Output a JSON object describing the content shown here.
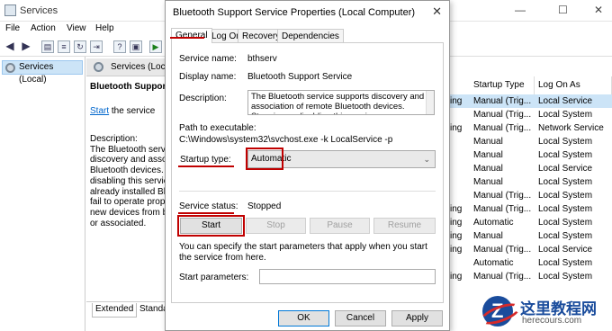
{
  "services_window": {
    "title": "Services",
    "controls": {
      "minimize": "—",
      "maximize": "☐",
      "close": "✕"
    },
    "menu": [
      "File",
      "Action",
      "View",
      "Help"
    ],
    "tree_item": "Services (Local)",
    "header": "Services (Local)",
    "desc_pane": {
      "title": "Bluetooth Support",
      "link": "Start",
      "link_suffix": " the service",
      "description_heading": "Description:",
      "description_lines": [
        "The Bluetooth servi",
        "discovery and asso",
        "Bluetooth devices.",
        "disabling this servic",
        "already installed Blu",
        "fail to operate prop",
        "new devices from b",
        "or associated."
      ]
    },
    "bottom_tabs": [
      "Extended",
      "Standa"
    ],
    "columns": {
      "startup_type": "Startup Type",
      "log_on_as": "Log On As"
    },
    "partial_cells": [
      "ing",
      "",
      "ing",
      "",
      "",
      "",
      "",
      "",
      "ing",
      "ing",
      "ing",
      "ing",
      "",
      "ing"
    ],
    "rows": [
      {
        "startup": "Manual (Trig...",
        "logon": "Local Service",
        "selected": true
      },
      {
        "startup": "Manual (Trig...",
        "logon": "Local System"
      },
      {
        "startup": "Manual (Trig...",
        "logon": "Network Service"
      },
      {
        "startup": "Manual",
        "logon": "Local System"
      },
      {
        "startup": "Manual",
        "logon": "Local System"
      },
      {
        "startup": "Manual",
        "logon": "Local Service"
      },
      {
        "startup": "Manual",
        "logon": "Local System"
      },
      {
        "startup": "Manual (Trig...",
        "logon": "Local System"
      },
      {
        "startup": "Manual (Trig...",
        "logon": "Local System"
      },
      {
        "startup": "Automatic",
        "logon": "Local System"
      },
      {
        "startup": "Manual",
        "logon": "Local System"
      },
      {
        "startup": "Manual (Trig...",
        "logon": "Local Service"
      },
      {
        "startup": "Automatic",
        "logon": "Local System"
      },
      {
        "startup": "Manual (Trig...",
        "logon": "Local System"
      }
    ]
  },
  "dialog": {
    "title": "Bluetooth Support Service Properties (Local Computer)",
    "close": "✕",
    "tabs": [
      "General",
      "Log On",
      "Recovery",
      "Dependencies"
    ],
    "service_name_label": "Service name:",
    "service_name": "bthserv",
    "display_name_label": "Display name:",
    "display_name": "Bluetooth Support Service",
    "description_label": "Description:",
    "description": "The Bluetooth service supports discovery and association of remote Bluetooth devices.  Stopping or disabling this service may cause already installed",
    "path_label": "Path to executable:",
    "path": "C:\\Windows\\system32\\svchost.exe -k LocalService -p",
    "startup_type_label": "Startup type:",
    "startup_type_value": "Automatic",
    "service_status_label": "Service status:",
    "service_status": "Stopped",
    "buttons": {
      "start": "Start",
      "stop": "Stop",
      "pause": "Pause",
      "resume": "Resume"
    },
    "hint": "You can specify the start parameters that apply when you start the service from here.",
    "start_params_label": "Start parameters:",
    "footer": {
      "ok": "OK",
      "cancel": "Cancel",
      "apply": "Apply"
    }
  },
  "watermark": {
    "logo_letter": "Z",
    "text": "这里教程网",
    "url": "herecours.com"
  },
  "colors": {
    "highlight": "#c00000",
    "selection": "#cce4f7"
  }
}
